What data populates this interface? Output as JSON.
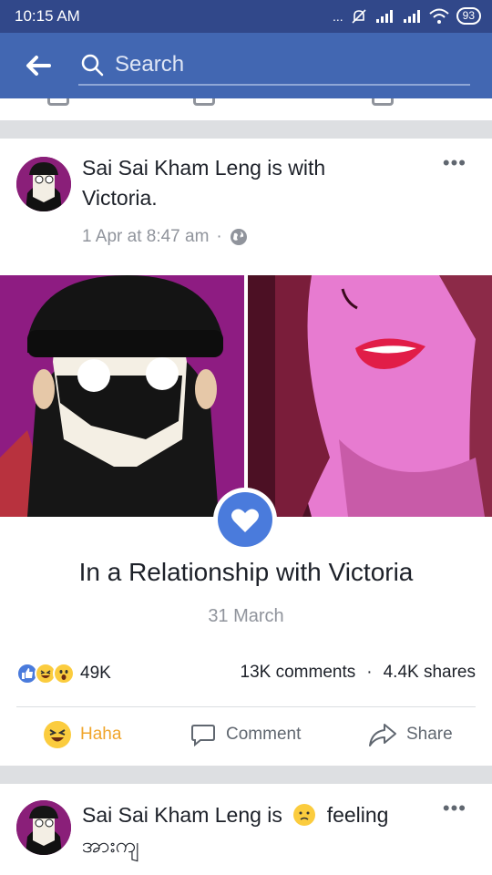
{
  "status_bar": {
    "time": "10:15 AM",
    "signal_dots": "...",
    "battery": "93"
  },
  "search": {
    "placeholder": "Search"
  },
  "post": {
    "author": "Sai Sai Kham Leng",
    "title_text": "Sai Sai Kham Leng is with",
    "title_continuation": "Victoria.",
    "timestamp": "1 Apr at 8:47 am",
    "separator": "·",
    "privacy_icon": "globe-icon",
    "more_label": "•••",
    "life_event": {
      "title": "In a Relationship with Victoria",
      "date": "31 March",
      "icon": "heart-icon"
    },
    "reactions": {
      "icons": [
        "like-icon",
        "haha-icon",
        "wow-icon"
      ],
      "count": "49K"
    },
    "comments_count": "13K comments",
    "shares_count": "4.4K shares",
    "actions": {
      "haha_label": "Haha",
      "comment_label": "Comment",
      "share_label": "Share"
    }
  },
  "next_post": {
    "title_text": "Sai Sai Kham Leng is",
    "feeling_label": "feeling",
    "feeling_value": "အားကျ",
    "more_label": "•••"
  },
  "colors": {
    "status_bar": "#31488a",
    "header": "#4267b2",
    "accent": "#4a7bdc",
    "haha": "#f0a52b",
    "text": "#1d2129",
    "muted": "#90949c"
  }
}
